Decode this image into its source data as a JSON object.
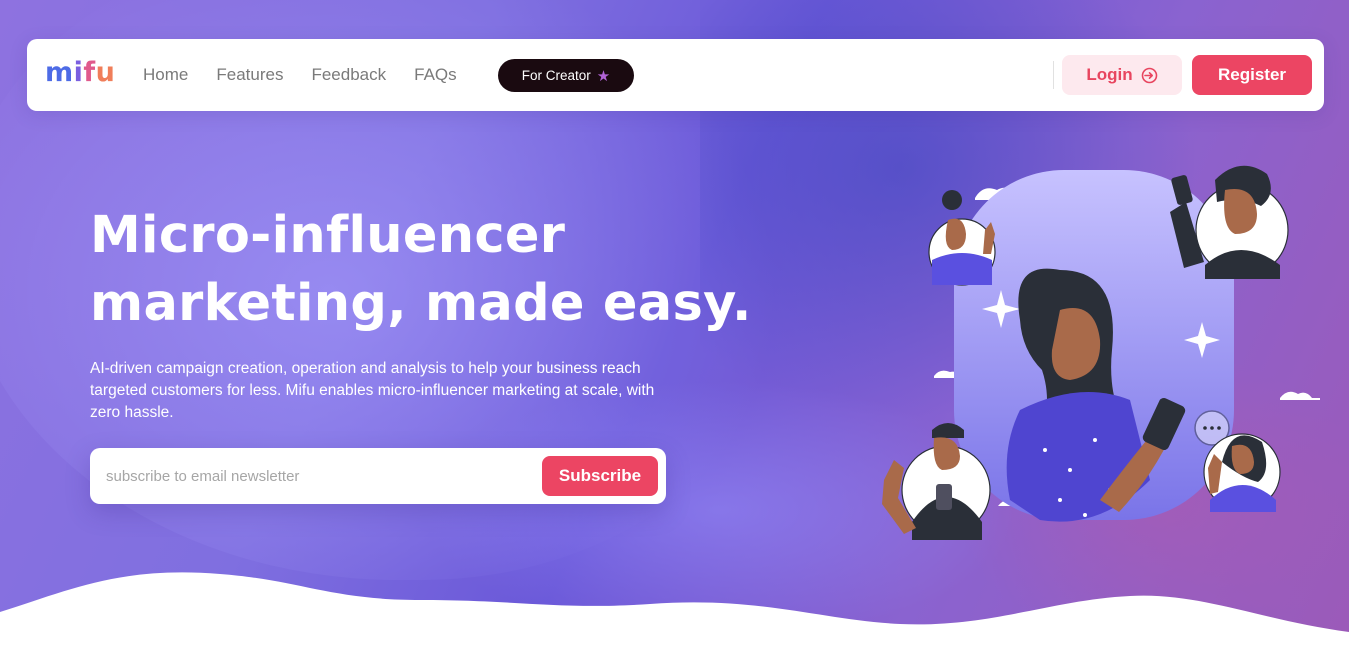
{
  "brand": {
    "logo_text": "mifu",
    "accent": "#ec4563",
    "dark": "#1a0a10"
  },
  "nav": {
    "links": [
      "Home",
      "Features",
      "Feedback",
      "FAQs"
    ],
    "creator_label": "For Creator",
    "creator_icon": "star-icon",
    "login_label": "Login",
    "login_icon": "login-arrow-icon",
    "register_label": "Register"
  },
  "hero": {
    "title_line1": "Micro-influencer",
    "title_line2": "marketing, made easy.",
    "description": "AI-driven campaign creation, operation and analysis to help your business reach targeted customers for less. Mifu enables micro-influencer marketing at scale, with zero hassle."
  },
  "subscribe": {
    "placeholder": "subscribe to email newsletter",
    "value": "",
    "button_label": "Subscribe"
  },
  "illustration": {
    "name": "influencer-illustration"
  }
}
